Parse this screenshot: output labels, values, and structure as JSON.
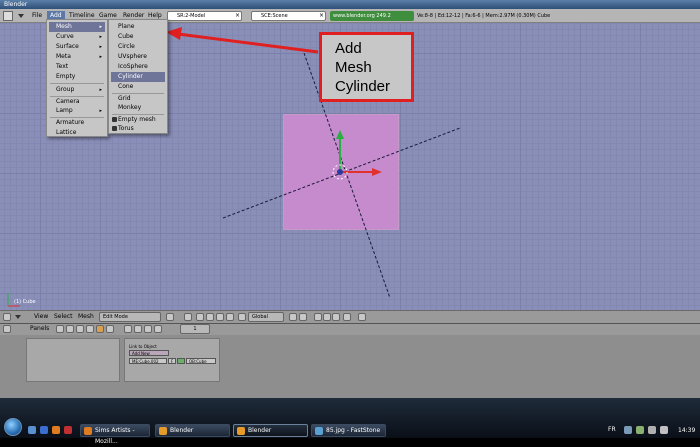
{
  "window": {
    "title": "Blender"
  },
  "menubar": {
    "items": [
      "File",
      "Add",
      "Timeline",
      "Game",
      "Render",
      "Help"
    ],
    "screen_field": "SR:2-Model",
    "scene_field": "SCE:Scene",
    "url": "www.blender.org 249.2",
    "stats": "Ve:8-8 | Ed:12-12 | Fa:6-6 | Mem:2.97M (0.30M) Cube"
  },
  "add_menu": {
    "items": [
      {
        "label": "Mesh",
        "submenu": true,
        "highlight": true
      },
      {
        "label": "Curve",
        "submenu": true
      },
      {
        "label": "Surface",
        "submenu": true
      },
      {
        "label": "Meta",
        "submenu": true
      },
      {
        "label": "Text"
      },
      {
        "label": "Empty"
      },
      {
        "label": "Group",
        "submenu": true
      },
      {
        "label": "Camera"
      },
      {
        "label": "Lamp",
        "submenu": true
      },
      {
        "label": "Armature"
      },
      {
        "label": "Lattice"
      }
    ]
  },
  "mesh_submenu": {
    "items": [
      {
        "label": "Plane"
      },
      {
        "label": "Cube"
      },
      {
        "label": "Circle"
      },
      {
        "label": "UVsphere"
      },
      {
        "label": "IcoSphere"
      },
      {
        "label": "Cylinder",
        "highlight": true
      },
      {
        "label": "Cone"
      },
      {
        "label": "Grid"
      },
      {
        "label": "Monkey"
      },
      {
        "label": "Empty mesh"
      },
      {
        "label": "Torus"
      }
    ]
  },
  "annotation": {
    "lines": [
      "Add",
      "Mesh",
      "Cylinder"
    ],
    "border_color": "#e02020"
  },
  "viewport": {
    "object_label": "(1) Cube"
  },
  "viewport_header": {
    "view": "View",
    "select": "Select",
    "mesh": "Mesh",
    "mode": "Edit Mode",
    "orientation": "Global"
  },
  "buttons_header": {
    "panels": "Panels",
    "frame": "1"
  },
  "buttons_panel": {
    "link_label": "Link to Object",
    "add_new": "Add New",
    "row_a": "ME:Cube.002",
    "row_b": "F",
    "row_c": "OB:Cube"
  },
  "taskbar": {
    "tasks": [
      {
        "label": "Sims Artists - Mozill...",
        "active": false
      },
      {
        "label": "Blender",
        "active": false
      },
      {
        "label": "Blender",
        "active": true
      },
      {
        "label": "85.jpg - FastStone",
        "active": false
      }
    ],
    "lang": "FR",
    "time": "14:39"
  },
  "colors": {
    "viewport_bg": "#8a8fb8",
    "cube_face": "#c68bcc",
    "menu_highlight": "#6e7599"
  }
}
